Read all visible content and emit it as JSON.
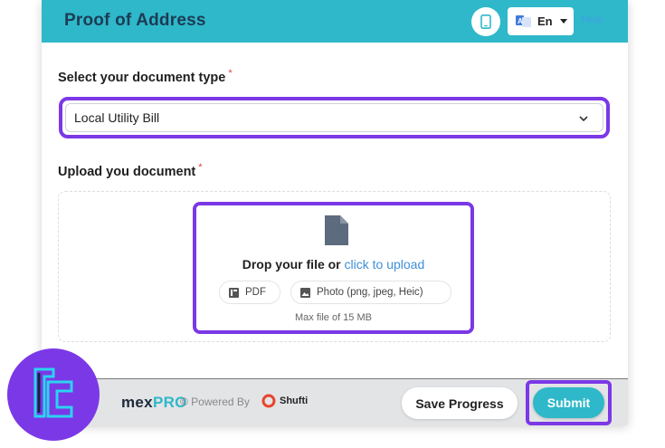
{
  "header": {
    "title": "Proof of Address",
    "language": "En",
    "help_label": "Help"
  },
  "document_type": {
    "label": "Select your document type",
    "required_mark": "*",
    "selected_value": "Local Utility Bill"
  },
  "upload": {
    "label": "Upload you document",
    "required_mark": "*",
    "drop_text": "Drop your file or",
    "upload_link": "click to upload",
    "formats": [
      {
        "label": "PDF",
        "icon": "pdf-icon"
      },
      {
        "label": "Photo (png, jpeg, Heic)",
        "icon": "image-icon"
      }
    ],
    "max_size": "Max file of 15 MB"
  },
  "footer": {
    "brand_prefix": "mex",
    "brand_suffix": "PRO",
    "powered_by": "© Powered By",
    "provider": "Shufti",
    "save_label": "Save Progress",
    "submit_label": "Submit"
  },
  "colors": {
    "header_bg": "#2eb8c9",
    "highlight": "#7b38e6",
    "submit_bg": "#2eb8c9",
    "title": "#1d3b55"
  }
}
